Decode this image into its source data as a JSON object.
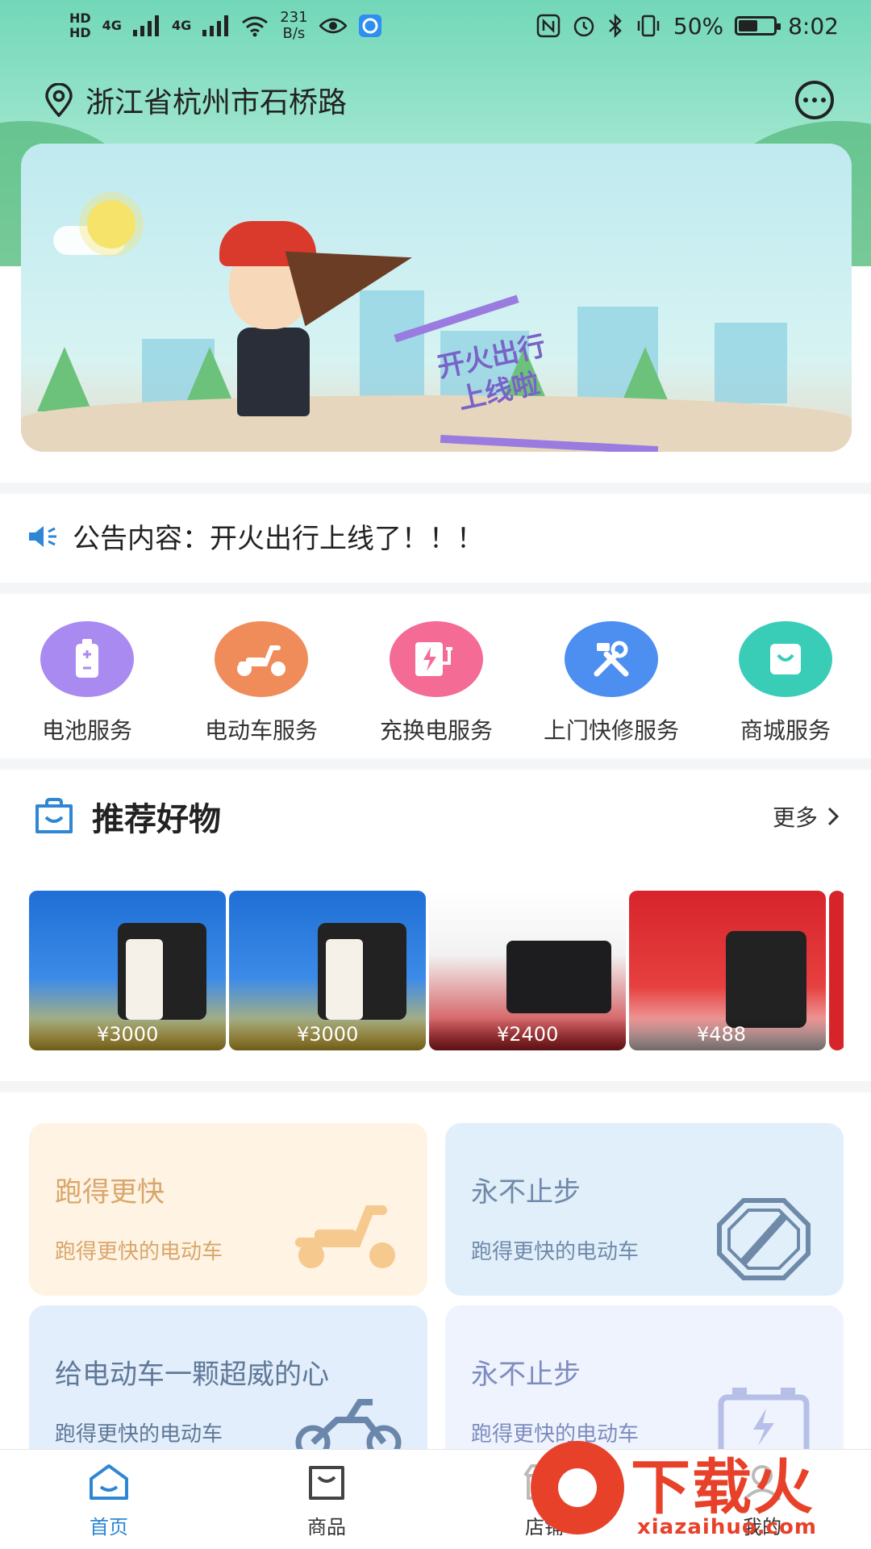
{
  "status_bar": {
    "hd1": "HD",
    "hd2": "HD",
    "net1": "4G",
    "net2": "4G",
    "speed_value": "231",
    "speed_unit": "B/s",
    "battery": "50%",
    "time": "8:02"
  },
  "header": {
    "location": "浙江省杭州市石桥路"
  },
  "banner": {
    "text_line1": "开火出行",
    "text_line2": "上线啦"
  },
  "notice": {
    "text": "公告内容：开火出行上线了！！！"
  },
  "services": [
    {
      "label": "电池服务",
      "color": "#a98af0",
      "icon": "battery-icon"
    },
    {
      "label": "电动车服务",
      "color": "#f08c5a",
      "icon": "scooter-icon"
    },
    {
      "label": "充换电服务",
      "color": "#f46b95",
      "icon": "charging-icon"
    },
    {
      "label": "上门快修服务",
      "color": "#4c8ff0",
      "icon": "tools-icon"
    },
    {
      "label": "商城服务",
      "color": "#39cdb8",
      "icon": "shopping-bag-icon"
    }
  ],
  "recommend": {
    "title": "推荐好物",
    "more": "更多"
  },
  "products": [
    {
      "price": "¥3000"
    },
    {
      "price": "¥3000"
    },
    {
      "price": "¥2400"
    },
    {
      "price": "¥488"
    }
  ],
  "cards": [
    {
      "title": "跑得更快",
      "subtitle": "跑得更快的电动车",
      "bg": "#fff3e4",
      "title_color": "#d9a66a",
      "icon": "scooter-icon"
    },
    {
      "title": "永不止步",
      "subtitle": "跑得更快的电动车",
      "bg": "#e1effb",
      "title_color": "#6e8aa8",
      "icon": "stop-sign-icon"
    },
    {
      "title": "给电动车一颗超威的心",
      "subtitle": "跑得更快的电动车",
      "bg": "#e2eefb",
      "title_color": "#5f7898",
      "icon": "motorcycle-icon"
    },
    {
      "title": "永不止步",
      "subtitle": "跑得更快的电动车",
      "bg": "#eef3fd",
      "title_color": "#7d8cc0",
      "icon": "battery-charge-icon"
    }
  ],
  "tabbar": [
    {
      "label": "首页",
      "active": true,
      "icon": "home-icon"
    },
    {
      "label": "商品",
      "active": false,
      "icon": "shopping-bag-icon"
    },
    {
      "label": "店铺",
      "active": false,
      "icon": "store-icon"
    },
    {
      "label": "我的",
      "active": false,
      "icon": "user-icon"
    }
  ],
  "watermark": {
    "text": "下载火",
    "url": "xiazaihuo.com"
  }
}
